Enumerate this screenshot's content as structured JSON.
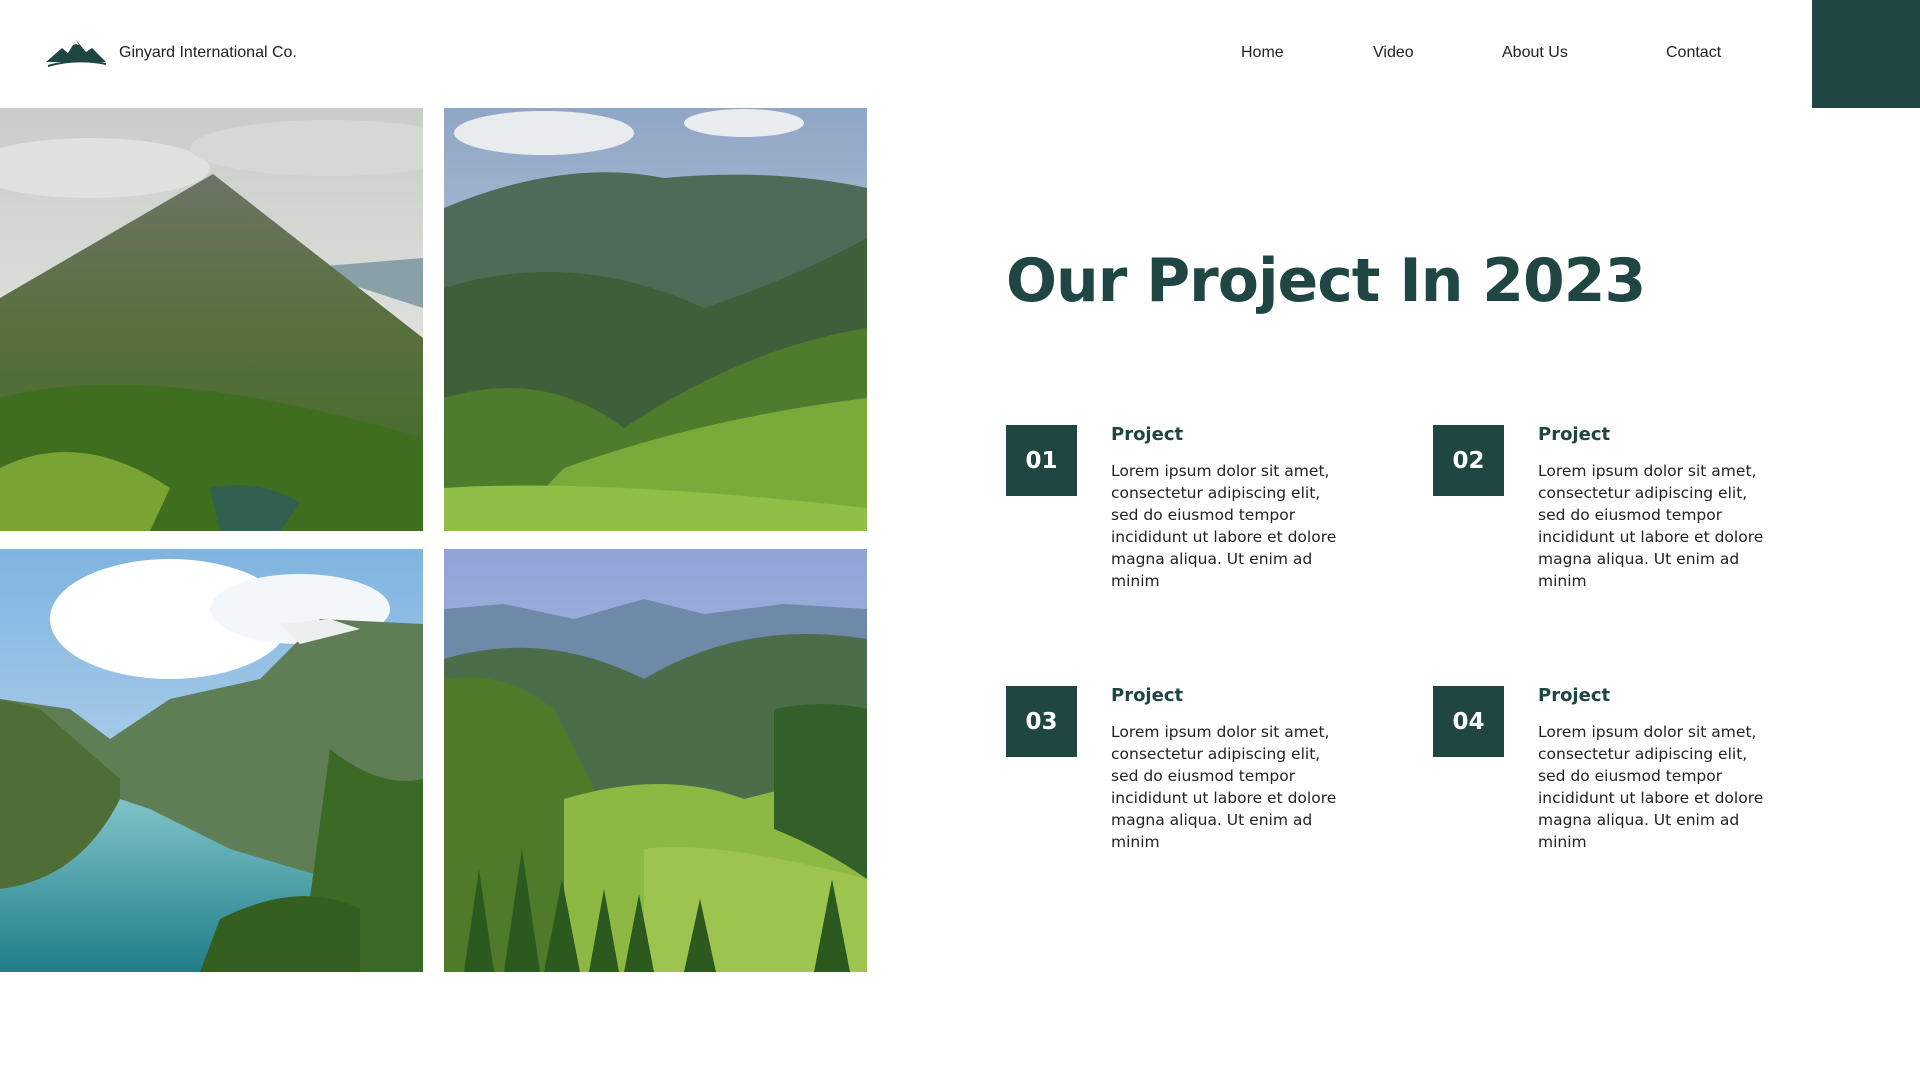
{
  "header": {
    "brand": "Ginyard International Co.",
    "nav": [
      "Home",
      "Video",
      "About Us",
      "Contact"
    ]
  },
  "gallery": [
    {
      "icon": "mountain-peak-photo"
    },
    {
      "icon": "mountain-valley-photo"
    },
    {
      "icon": "fjord-river-photo"
    },
    {
      "icon": "alpine-forest-photo"
    }
  ],
  "main": {
    "heading": "Our Project In 2023",
    "projects": [
      {
        "number": "01",
        "title": "Project",
        "text": "Lorem ipsum dolor sit amet, consectetur adipiscing elit, sed do eiusmod tempor incididunt ut labore et dolore magna aliqua. Ut enim ad minim"
      },
      {
        "number": "02",
        "title": "Project",
        "text": "Lorem ipsum dolor sit amet, consectetur adipiscing elit, sed do eiusmod tempor incididunt ut labore et dolore magna aliqua. Ut enim ad minim"
      },
      {
        "number": "03",
        "title": "Project",
        "text": "Lorem ipsum dolor sit amet, consectetur adipiscing elit, sed do eiusmod tempor incididunt ut labore et dolore magna aliqua. Ut enim ad minim"
      },
      {
        "number": "04",
        "title": "Project",
        "text": "Lorem ipsum dolor sit amet, consectetur adipiscing elit, sed do eiusmod tempor incididunt ut labore et dolore magna aliqua. Ut enim ad minim"
      }
    ]
  },
  "colors": {
    "accent": "#1f4643",
    "background": "#ffffff",
    "text": "#222222"
  }
}
